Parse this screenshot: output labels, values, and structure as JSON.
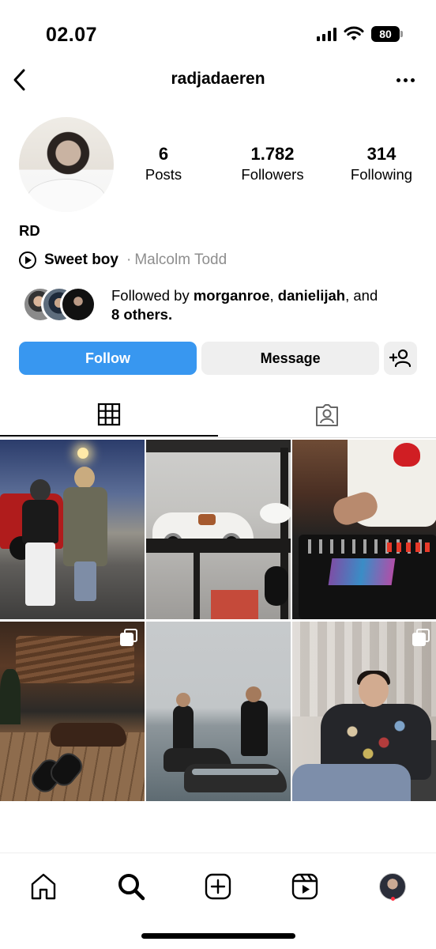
{
  "status_bar": {
    "time": "02.07",
    "battery": "80",
    "icons": [
      "signal-icon",
      "wifi-icon",
      "battery-icon"
    ]
  },
  "header": {
    "username": "radjadaeren",
    "back_icon": "chevron-left-icon",
    "more_icon": "more-horizontal-icon"
  },
  "profile": {
    "display_name": "RD",
    "stats": [
      {
        "value": "6",
        "label": "Posts"
      },
      {
        "value": "1.782",
        "label": "Followers"
      },
      {
        "value": "314",
        "label": "Following"
      }
    ],
    "music": {
      "icon": "play-circle-icon",
      "title": "Sweet boy",
      "separator": "·",
      "artist": "Malcolm Todd"
    },
    "followed_by": {
      "prefix": "Followed by ",
      "user1": "morganroe",
      "comma": ", ",
      "user2": "danielijah",
      "suffix": ", and",
      "others": "8 others."
    }
  },
  "actions": {
    "follow": "Follow",
    "message": "Message",
    "add_icon": "add-person-icon"
  },
  "tabs": [
    {
      "name": "grid",
      "icon": "grid-icon",
      "active": true
    },
    {
      "name": "tagged",
      "icon": "tagged-person-icon",
      "active": false
    }
  ],
  "posts": [
    {
      "id": 1,
      "multi": false
    },
    {
      "id": 2,
      "multi": false
    },
    {
      "id": 3,
      "multi": false
    },
    {
      "id": 4,
      "multi": true
    },
    {
      "id": 5,
      "multi": false
    },
    {
      "id": 6,
      "multi": true
    }
  ],
  "bottom_nav": [
    "home-icon",
    "search-icon",
    "create-icon",
    "reels-icon",
    "profile-avatar"
  ],
  "colors": {
    "follow_button": "#3897f0",
    "secondary_button": "#efefef",
    "muted_text": "#8e8e8e",
    "notification_dot": "#ff3040"
  }
}
